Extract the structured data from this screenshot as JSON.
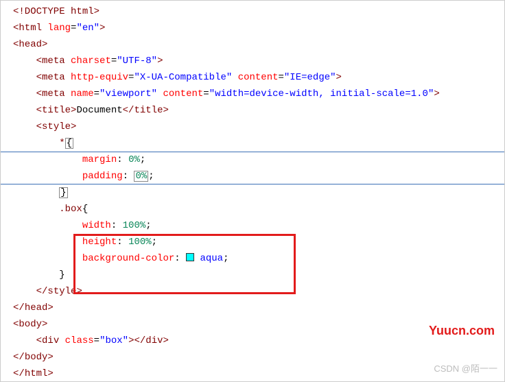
{
  "code": {
    "doctype": "<!DOCTYPE html>",
    "html_open": "html",
    "html_lang_attr": "lang",
    "html_lang_val": "\"en\"",
    "head_open": "head",
    "meta1_attr": "charset",
    "meta1_val": "\"UTF-8\"",
    "meta2_attr1": "http-equiv",
    "meta2_val1": "\"X-UA-Compatible\"",
    "meta2_attr2": "content",
    "meta2_val2": "\"IE=edge\"",
    "meta3_attr1": "name",
    "meta3_val1": "\"viewport\"",
    "meta3_attr2": "content",
    "meta3_val2": "\"width=device-width, initial-scale=1.0\"",
    "title_tag": "title",
    "title_text": "Document",
    "style_tag": "style",
    "sel_star": "*",
    "prop_margin": "margin",
    "val_margin": "0%",
    "prop_padding": "padding",
    "val_padding": "0%",
    "sel_box": ".box",
    "prop_width": "width",
    "val_width": "100%",
    "prop_height": "height",
    "val_height": "100%",
    "prop_bgcolor": "background-color",
    "val_bgcolor": "aqua",
    "swatch_color": "#00ffff",
    "head_close": "head",
    "body_tag": "body",
    "div_tag": "div",
    "div_attr": "class",
    "div_val": "\"box\"",
    "html_close": "html"
  },
  "watermarks": {
    "site": "Yuucn.com",
    "author": "CSDN @陌一一"
  }
}
